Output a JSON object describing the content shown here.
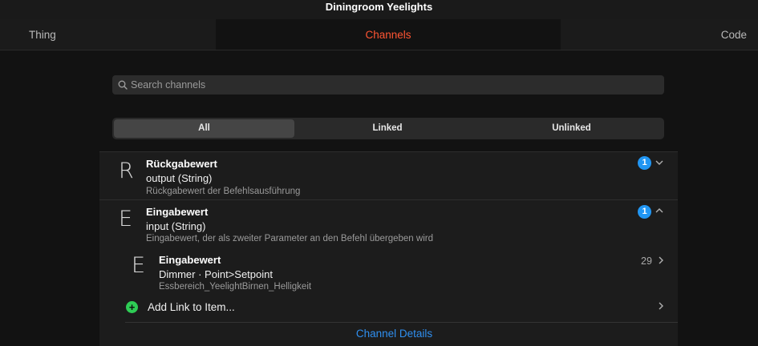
{
  "window": {
    "title": "Diningroom Yeelights"
  },
  "tabs": [
    {
      "label": "Thing"
    },
    {
      "label": "Channels"
    },
    {
      "label": "Code"
    }
  ],
  "search": {
    "placeholder": "Search channels",
    "value": ""
  },
  "filter": {
    "options": [
      "All",
      "Linked",
      "Unlinked"
    ],
    "selected": "All"
  },
  "channels": [
    {
      "letter": "R",
      "label": "Rückgabewert",
      "type": "output (String)",
      "description": "Rückgabewert der Befehlsausführung",
      "link_count": "1",
      "expanded": false
    },
    {
      "letter": "E",
      "label": "Eingabewert",
      "type": "input (String)",
      "description": "Eingabewert, der als zweiter Parameter an den Befehl übergeben wird",
      "link_count": "1",
      "expanded": true
    }
  ],
  "linked_item": {
    "letter": "E",
    "label": "Eingabewert",
    "semantics": "Dimmer · Point>Setpoint",
    "name": "Essbereich_YeelightBirnen_Helligkeit",
    "state": "29"
  },
  "actions": {
    "add_link": "Add Link to Item...",
    "channel_details": "Channel Details"
  },
  "colors": {
    "accent_tab": "#ff5533",
    "badge": "#2196f3",
    "link": "#2f8ff0",
    "add": "#2ecc55"
  }
}
